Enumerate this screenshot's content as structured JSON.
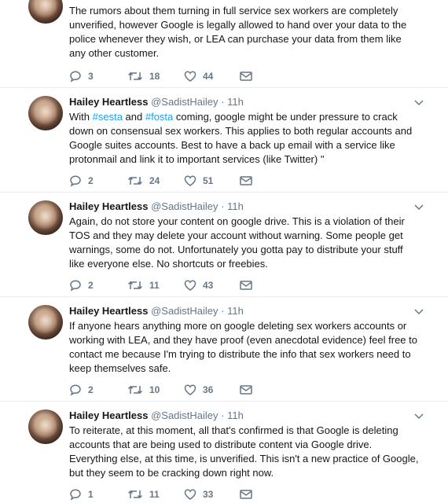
{
  "tweets": [
    {
      "name": "",
      "handle": "",
      "time": "",
      "text": "The rumors about them turning in full service sex workers are completely unverified, however Google is legally allowed to hand over your data to the police whenever they wish, or LEA can purchase your data from them like any other customer.",
      "replies": "3",
      "retweets": "18",
      "likes": "44"
    },
    {
      "name": "Hailey Heartless",
      "handle": "@SadistHailey",
      "dot": "·",
      "time": "11h",
      "text_parts": [
        "With ",
        "#sesta",
        " and ",
        "#fosta",
        " coming, google might be under pressure to crack down on consensual sex workers. This applies to both regular accounts and Google suites accounts. Best to have a back up email with a service like protonmail and link it to important services (like Twitter) \""
      ],
      "replies": "2",
      "retweets": "24",
      "likes": "51"
    },
    {
      "name": "Hailey Heartless",
      "handle": "@SadistHailey",
      "dot": "·",
      "time": "11h",
      "text": "Again, do not store your content on google drive. This is a violation of their TOS and they may delete your account without warning. Some people get warnings, some do not. Unfortunately you gotta pay to distribute your stuff like everyone else. No shortcuts or freebies.",
      "replies": "2",
      "retweets": "11",
      "likes": "43"
    },
    {
      "name": "Hailey Heartless",
      "handle": "@SadistHailey",
      "dot": "·",
      "time": "11h",
      "text": "If anyone hears anything more on google deleting sex workers accounts or working with LEA, and they have proof (even anecdotal evidence) feel free to contact me because I'm trying to distribute the info that sex workers need to keep themselves safe.",
      "replies": "2",
      "retweets": "10",
      "likes": "36"
    },
    {
      "name": "Hailey Heartless",
      "handle": "@SadistHailey",
      "dot": "·",
      "time": "11h",
      "text": "To reiterate, at this moment, all that's confirmed is that Google is deleting accounts that are being used to distribute content via Google drive. Everything else, at this time, is unverified. This isn't a new practice of Google, but they seem to be cracking down right now.",
      "replies": "1",
      "retweets": "11",
      "likes": "33"
    }
  ],
  "colors": {
    "accent": "#1da1f2",
    "muted": "#657786",
    "text": "#14171a",
    "divider": "#e6ecf0"
  },
  "icons": [
    "reply-icon",
    "retweet-icon",
    "like-icon",
    "direct-message-icon",
    "chevron-down-icon"
  ]
}
